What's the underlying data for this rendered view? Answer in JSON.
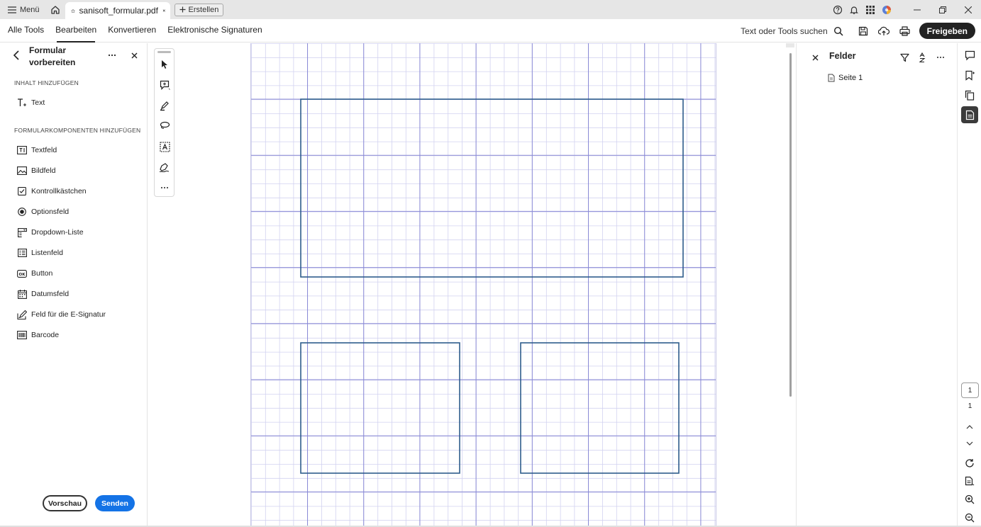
{
  "titlebar": {
    "menu_label": "Menü",
    "tab_title": "sanisoft_formular.pdf",
    "create_label": "Erstellen"
  },
  "menubar": {
    "tabs": [
      {
        "label": "Alle Tools"
      },
      {
        "label": "Bearbeiten"
      },
      {
        "label": "Konvertieren"
      },
      {
        "label": "Elektronische Signaturen"
      }
    ],
    "active_tab": "Bearbeiten",
    "search_label": "Text oder Tools suchen",
    "share_label": "Freigeben"
  },
  "left_panel": {
    "title": "Formular vorbereiten",
    "section_content": "INHALT HINZUFÜGEN",
    "text_item": "Text",
    "section_components": "FORMULARKOMPONENTEN HINZUFÜGEN",
    "items": [
      {
        "label": "Textfeld",
        "icon": "text-field-icon"
      },
      {
        "label": "Bildfeld",
        "icon": "image-field-icon"
      },
      {
        "label": "Kontrollkästchen",
        "icon": "checkbox-icon"
      },
      {
        "label": "Optionsfeld",
        "icon": "radio-icon"
      },
      {
        "label": "Dropdown-Liste",
        "icon": "dropdown-icon"
      },
      {
        "label": "Listenfeld",
        "icon": "listbox-icon"
      },
      {
        "label": "Button",
        "icon": "ok-button-icon"
      },
      {
        "label": "Datumsfeld",
        "icon": "calendar-icon"
      },
      {
        "label": "Feld für die E-Signatur",
        "icon": "esign-icon"
      },
      {
        "label": "Barcode",
        "icon": "barcode-icon"
      }
    ],
    "preview_label": "Vorschau",
    "send_label": "Senden"
  },
  "right_panel": {
    "title": "Felder",
    "page_item": "Seite 1"
  },
  "page_nav": {
    "current_page": "1",
    "total_pages": "1"
  },
  "colors": {
    "accent": "#1473e6",
    "grid_major": "#8b8bd6",
    "grid_minor": "#d2d2f0",
    "field_border": "#2e5d8c"
  }
}
